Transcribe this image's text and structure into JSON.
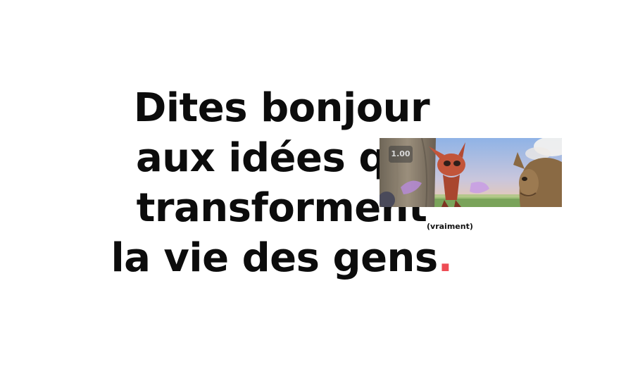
{
  "headline": {
    "line1": "Dites bonjour",
    "line2": "aux idées qui",
    "line3": "transforment",
    "line4": "la vie des gens",
    "punctuation": "."
  },
  "side_note": "(vraiment)",
  "video": {
    "speed_label": "1.00"
  },
  "colors": {
    "text": "#0c0c0c",
    "accent_dot": "#ee4c55",
    "background": "#ffffff"
  }
}
